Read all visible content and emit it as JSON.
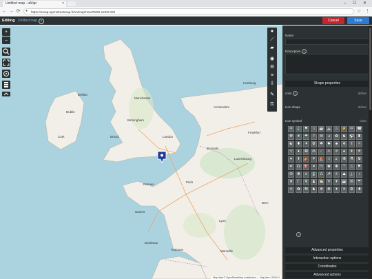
{
  "browser": {
    "tab_title": "Untitled map - uMap",
    "tab_close": "×",
    "window_controls": "– ☐ ✕",
    "url": "https://umap.openstreetmap.fr/en/map/new/#6/50.120/0.000",
    "back": "←",
    "forward": "→",
    "reload": "⟳",
    "lock": "🔒",
    "star": "☆",
    "menu": "⋮"
  },
  "app": {
    "editing_label": "Editing",
    "map_name": "Untitled map",
    "help": "?",
    "cancel_label": "Cancel",
    "save_label": "Save"
  },
  "map": {
    "zoom_in": "+",
    "zoom_out": "–",
    "attribution": "Map data © OpenStreetMap contributors — Map tiles: OSM-Fr"
  },
  "map_labels": [
    {
      "text": "Belfast"
    },
    {
      "text": "Dublin"
    },
    {
      "text": "Cork"
    },
    {
      "text": "Manchester"
    },
    {
      "text": "Birmingham"
    },
    {
      "text": "London"
    },
    {
      "text": "Bristol"
    },
    {
      "text": "Amsterdam"
    },
    {
      "text": "Brussels"
    },
    {
      "text": "Paris"
    },
    {
      "text": "Rennes"
    },
    {
      "text": "Nantes"
    },
    {
      "text": "Bordeaux"
    },
    {
      "text": "Lyon"
    },
    {
      "text": "Toulouse"
    },
    {
      "text": "Hamburg"
    },
    {
      "text": "Frankfurt"
    },
    {
      "text": "Luxembourg"
    },
    {
      "text": "Bern"
    },
    {
      "text": "Marseille"
    }
  ],
  "panel": {
    "name_label": "Name",
    "name_value": "",
    "description_label": "Description",
    "description_help": "?",
    "shape_properties": "Shape properties",
    "rows": [
      {
        "label": "color",
        "value": "define"
      },
      {
        "label": "Icon shape",
        "value": "define"
      },
      {
        "label": "Icon symbol",
        "value": "clear"
      }
    ],
    "icon_symbols": [
      "✈",
      "⚓",
      "⚑",
      "⌂",
      "☕",
      "⛪",
      "♨",
      "⚡",
      "✂",
      "☎",
      "⚒",
      "☀",
      "☂",
      "⚐",
      "✉",
      "♫",
      "✿",
      "♞",
      "⚽",
      "♜",
      "☯",
      "✚",
      "✦",
      "⚙",
      "☘",
      "✱",
      "♣",
      "❄",
      "⚕",
      "✧",
      "☆",
      "♦",
      "✪",
      "⚖",
      "☄",
      "⚠",
      "⚛",
      "♠",
      "✈",
      "⚜",
      "♥",
      "✝",
      "⛺",
      "⚘",
      "⛵",
      "☃",
      "♬",
      "✠",
      "⚗",
      "☢",
      "✒",
      "☊",
      "⛽",
      "⚭",
      "☈",
      "♚",
      "❖",
      "⚚",
      "♨",
      "⚑",
      "✇",
      "☸",
      "⚔",
      "⌛",
      "♺",
      "☭",
      "☉",
      "⛰",
      "⚓",
      "♁",
      "✵",
      "☾",
      "⚲",
      "♟",
      "⛅",
      "⚜",
      "✈",
      "☕",
      "✉",
      "☂",
      "⚛",
      "✿",
      "⚒",
      "♞",
      "❄",
      "☘",
      "✦",
      "☀",
      "⚙",
      "✚"
    ],
    "sections": [
      "Advanced properties",
      "Interaction options",
      "Coordinates",
      "Advanced actions"
    ]
  },
  "colors": {
    "header": "#2c3233",
    "cancel": "#c7252d",
    "save": "#2c7bd4",
    "sea": "#aad3df",
    "marker": "#1d3a96"
  }
}
